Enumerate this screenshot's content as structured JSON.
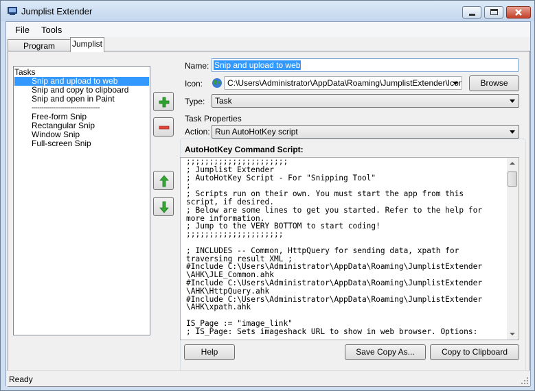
{
  "window": {
    "title": "Jumplist Extender"
  },
  "menu": {
    "file": "File",
    "tools": "Tools"
  },
  "tabs": [
    {
      "label": "Program Settings"
    },
    {
      "label": "Jumplist"
    }
  ],
  "tasks_list": {
    "items": [
      "Tasks",
      "Snip and upload to web",
      "Snip and copy to clipboard",
      "Snip and open in Paint",
      "-----------------------------------",
      "Free-form Snip",
      "Rectangular Snip",
      "Window Snip",
      "Full-screen Snip"
    ],
    "selected_index": 1
  },
  "form": {
    "name_label": "Name:",
    "name_value": "Snip and upload to web",
    "icon_label": "Icon:",
    "icon_value": "C:\\Users\\Administrator\\AppData\\Roaming\\JumplistExtender\\Icons\\I",
    "browse_label": "Browse",
    "type_label": "Type:",
    "type_value": "Task"
  },
  "task_properties": {
    "legend": "Task Properties",
    "action_label": "Action:",
    "action_value": "Run AutoHotKey script",
    "script_heading": "AutoHotKey Command Script:",
    "script_text": ";;;;;;;;;;;;;;;;;;;;;;\n; Jumplist Extender\n; AutoHotKey Script - For \"Snipping Tool\"\n;\n; Scripts run on their own. You must start the app from this\nscript, if desired.\n; Below are some lines to get you started. Refer to the help for\nmore information.\n; Jump to the VERY BOTTOM to start coding!\n;;;;;;;;;;;;;;;;;;;;;\n\n; INCLUDES -- Common, HttpQuery for sending data, xpath for\ntraversing result XML ;\n#Include C:\\Users\\Administrator\\AppData\\Roaming\\JumplistExtender\n\\AHK\\JLE_Common.ahk\n#Include C:\\Users\\Administrator\\AppData\\Roaming\\JumplistExtender\n\\AHK\\HttpQuery.ahk\n#Include C:\\Users\\Administrator\\AppData\\Roaming\\JumplistExtender\n\\AHK\\xpath.ahk\n\nIS_Page := \"image_link\"\n; IS_Page: Sets imageshack URL to show in web browser. Options:",
    "help_label": "Help",
    "save_copy_label": "Save Copy As...",
    "copy_clipboard_label": "Copy to Clipboard"
  },
  "status": {
    "text": "Ready"
  },
  "colors": {
    "selection": "#3399ff",
    "add_icon": "#2ea22e",
    "remove_icon": "#e0443a",
    "arrow_icon": "#35a535"
  }
}
